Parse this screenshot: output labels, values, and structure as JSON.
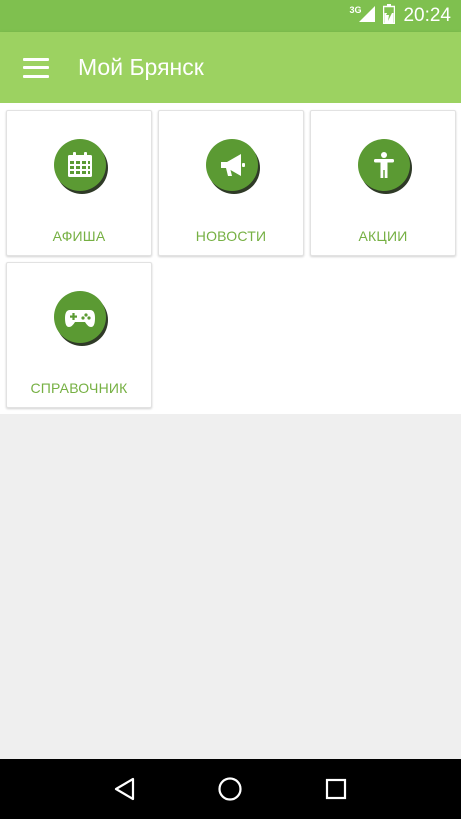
{
  "status_bar": {
    "network": "3G",
    "time": "20:24"
  },
  "app_bar": {
    "title": "Мой Брянск"
  },
  "tiles": [
    {
      "label": "АФИША",
      "icon": "calendar-icon"
    },
    {
      "label": "НОВОСТИ",
      "icon": "megaphone-icon"
    },
    {
      "label": "АКЦИИ",
      "icon": "person-icon"
    },
    {
      "label": "СПРАВОЧНИК",
      "icon": "gamepad-icon"
    }
  ],
  "nav_bar": {
    "icons": [
      "back-icon",
      "home-icon",
      "recent-apps-icon"
    ]
  },
  "colors": {
    "status_bar": "#7fc04f",
    "app_bar": "#9cd261",
    "accent_text": "#76b043",
    "icon_circle": "#5b9a33",
    "background": "#efefef"
  }
}
